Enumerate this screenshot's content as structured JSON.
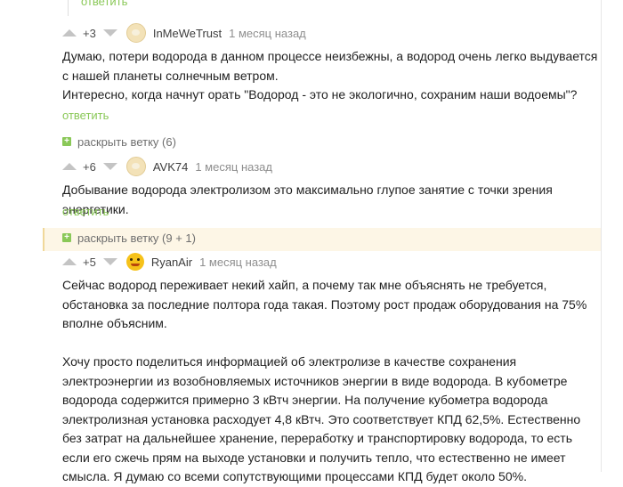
{
  "previous": {
    "reply_label": "ответить"
  },
  "comments": [
    {
      "rating": "+3",
      "author": "InMeWeTrust",
      "time": "1 месяц назад",
      "lines": [
        "Думаю, потери водорода в данном процессе неизбежны, а водород очень легко выдувается с нашей планеты солнечным ветром.",
        "Интересно, когда начнут орать \"Водород - это не экологично, сохраним наши водоемы\"?"
      ],
      "reply_label": "ответить",
      "expand_label": "раскрыть ветку (6)"
    },
    {
      "rating": "+6",
      "author": "AVK74",
      "time": "1 месяц назад",
      "lines": [
        "Добывание водорода электролизом это максимально глупое занятие с точки зрения энергетики."
      ],
      "reply_label": "ответить",
      "expand_label": "раскрыть ветку (9 + 1)"
    },
    {
      "rating": "+5",
      "author": "RyanAir",
      "time": "1 месяц назад",
      "paragraphs": [
        "Сейчас водород переживает некий хайп, а почему так мне объяснять не требуется, обстановка за последние полтора года такая. Поэтому рост продаж оборудования на 75% вполне объясним.",
        "Хочу просто поделиться информацией об электролизе в качестве сохранения электроэнергии из возобновляемых источников энергии в виде водорода. В кубометре водорода содержится примерно 3 кВтч энергии. На получение кубометра водорода электролизная установка расходует 4,8 кВтч. Это соответствует КПД 62,5%. Естественно без затрат на дальнейшее хранение, переработку и транспортировку водорода, то есть если его сжечь прям на выходе установки и получить тепло, что естественно не имеет смысла. Я думаю со всеми сопутствующими процессами КПД будет около 50%."
      ]
    }
  ]
}
